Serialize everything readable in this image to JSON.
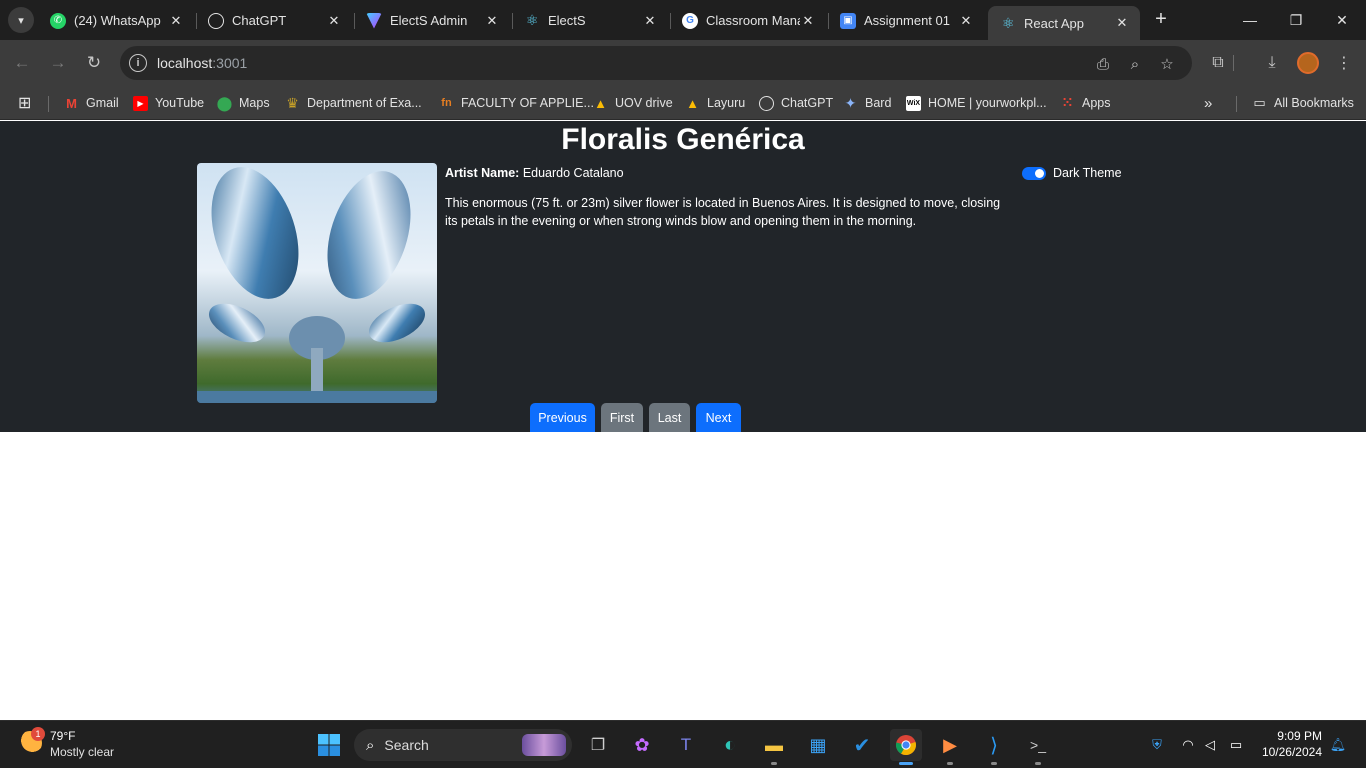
{
  "browser": {
    "tabs": [
      {
        "title": "(24) WhatsApp",
        "icon": "whatsapp-icon",
        "color": "#25d366"
      },
      {
        "title": "ChatGPT",
        "icon": "chatgpt-icon",
        "color": "#3c3c3c"
      },
      {
        "title": "ElectS Admin",
        "icon": "vite-icon",
        "color": "#9b59ff"
      },
      {
        "title": "ElectS",
        "icon": "react-icon",
        "color": "#61dafb"
      },
      {
        "title": "Classroom Mana",
        "icon": "google-icon",
        "color": "#ffffff"
      },
      {
        "title": "Assignment 01",
        "icon": "classroom-icon",
        "color": "#4285f4"
      },
      {
        "title": "React App",
        "icon": "react-icon",
        "color": "#61dafb"
      }
    ],
    "active_tab": 6,
    "address": {
      "host": "localhost",
      "port": ":3001"
    },
    "bookmarks": [
      {
        "label": "Gmail",
        "icon": "gmail-icon",
        "color": "#ea4335"
      },
      {
        "label": "YouTube",
        "icon": "youtube-icon",
        "color": "#ff0000"
      },
      {
        "label": "Maps",
        "icon": "maps-icon",
        "color": "#34a853"
      },
      {
        "label": "Department of Exa...",
        "icon": "crest-icon",
        "color": "#c9a227"
      },
      {
        "label": "FACULTY OF APPLIE...",
        "icon": "faculty-icon",
        "color": "#e67e22"
      },
      {
        "label": "UOV drive",
        "icon": "drive-icon",
        "color": "#fbbc04"
      },
      {
        "label": "Layuru",
        "icon": "drive-icon",
        "color": "#fbbc04"
      },
      {
        "label": "ChatGPT",
        "icon": "chatgpt-icon",
        "color": "#3c3c3c"
      },
      {
        "label": "Bard",
        "icon": "sparkle-icon",
        "color": "#8ab4f8"
      },
      {
        "label": "HOME | yourworkpl...",
        "icon": "wix-icon",
        "color": "#ffffff"
      },
      {
        "label": "Apps",
        "icon": "apps-grid-icon",
        "color": "#ea4335"
      }
    ],
    "all_bookmarks_label": "All Bookmarks"
  },
  "app": {
    "title": "Floralis Genérica",
    "artist_label": "Artist Name:",
    "artist_name": "Eduardo Catalano",
    "description": "This enormous (75 ft. or 23m) silver flower is located in Buenos Aires. It is designed to move, closing its petals in the evening or when strong winds blow and opening them in the morning.",
    "theme_toggle": {
      "label": "Dark Theme",
      "checked": true
    },
    "buttons": {
      "previous": "Previous",
      "first": "First",
      "last": "Last",
      "next": "Next"
    },
    "colors": {
      "background": "#212529",
      "primary": "#0d6efd",
      "secondary": "#6c757d"
    }
  },
  "taskbar": {
    "weather": {
      "temp": "79°F",
      "condition": "Mostly clear",
      "badge": "1"
    },
    "search_placeholder": "Search",
    "clock": {
      "time": "9:09 PM",
      "date": "10/26/2024"
    }
  }
}
